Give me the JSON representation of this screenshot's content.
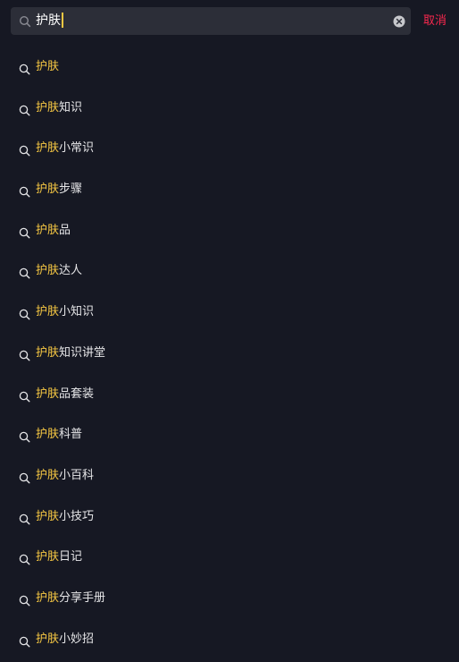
{
  "search": {
    "query": "护肤",
    "cancel_label": "取消"
  },
  "colors": {
    "background": "#161823",
    "search_field": "#2c2e38",
    "highlight": "#f7c843",
    "cancel": "#f8284e",
    "text": "#e6e6e8"
  },
  "icons": {
    "search_field": "search-icon",
    "clear": "clear-icon",
    "suggestion": "search-icon"
  },
  "suggestions": [
    {
      "highlight": "护肤",
      "rest": ""
    },
    {
      "highlight": "护肤",
      "rest": "知识"
    },
    {
      "highlight": "护肤",
      "rest": "小常识"
    },
    {
      "highlight": "护肤",
      "rest": "步骤"
    },
    {
      "highlight": "护肤",
      "rest": "品"
    },
    {
      "highlight": "护肤",
      "rest": "达人"
    },
    {
      "highlight": "护肤",
      "rest": "小知识"
    },
    {
      "highlight": "护肤",
      "rest": "知识讲堂"
    },
    {
      "highlight": "护肤",
      "rest": "品套装"
    },
    {
      "highlight": "护肤",
      "rest": "科普"
    },
    {
      "highlight": "护肤",
      "rest": "小百科"
    },
    {
      "highlight": "护肤",
      "rest": "小技巧"
    },
    {
      "highlight": "护肤",
      "rest": "日记"
    },
    {
      "highlight": "护肤",
      "rest": "分享手册"
    },
    {
      "highlight": "护肤",
      "rest": "小妙招"
    }
  ]
}
